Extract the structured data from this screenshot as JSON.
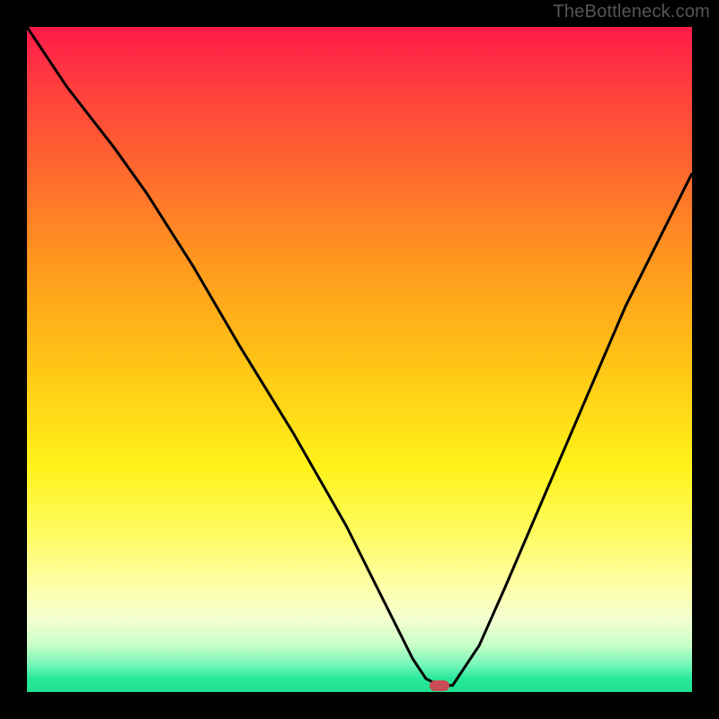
{
  "watermark": {
    "text": "TheBottleneck.com"
  },
  "colors": {
    "frame_bg": "#000000",
    "watermark_text": "#555555",
    "curve_stroke": "#000000",
    "marker_fill": "#c84d55"
  },
  "chart_data": {
    "type": "line",
    "title": "",
    "xlabel": "",
    "ylabel": "",
    "xlim": [
      0,
      100
    ],
    "ylim": [
      0,
      100
    ],
    "grid": false,
    "legend": false,
    "series": [
      {
        "name": "bottleneck-curve",
        "x": [
          0,
          6,
          13,
          18,
          25,
          32,
          40,
          48,
          55,
          58,
          60,
          62,
          64,
          68,
          72,
          78,
          84,
          90,
          96,
          100
        ],
        "values": [
          100,
          91,
          82,
          75,
          64,
          52,
          39,
          25,
          11,
          5,
          2,
          1,
          1,
          7,
          16,
          30,
          44,
          58,
          70,
          78
        ]
      }
    ],
    "marker": {
      "x_percent": 62,
      "y_percent": 1
    },
    "background_gradient_stops": [
      {
        "pos": 0,
        "color": "#ff1a4a"
      },
      {
        "pos": 22,
        "color": "#ff6a2e"
      },
      {
        "pos": 52,
        "color": "#ffc815"
      },
      {
        "pos": 76,
        "color": "#fffb60"
      },
      {
        "pos": 93,
        "color": "#c8ffc8"
      },
      {
        "pos": 100,
        "color": "#1fe08f"
      }
    ]
  }
}
